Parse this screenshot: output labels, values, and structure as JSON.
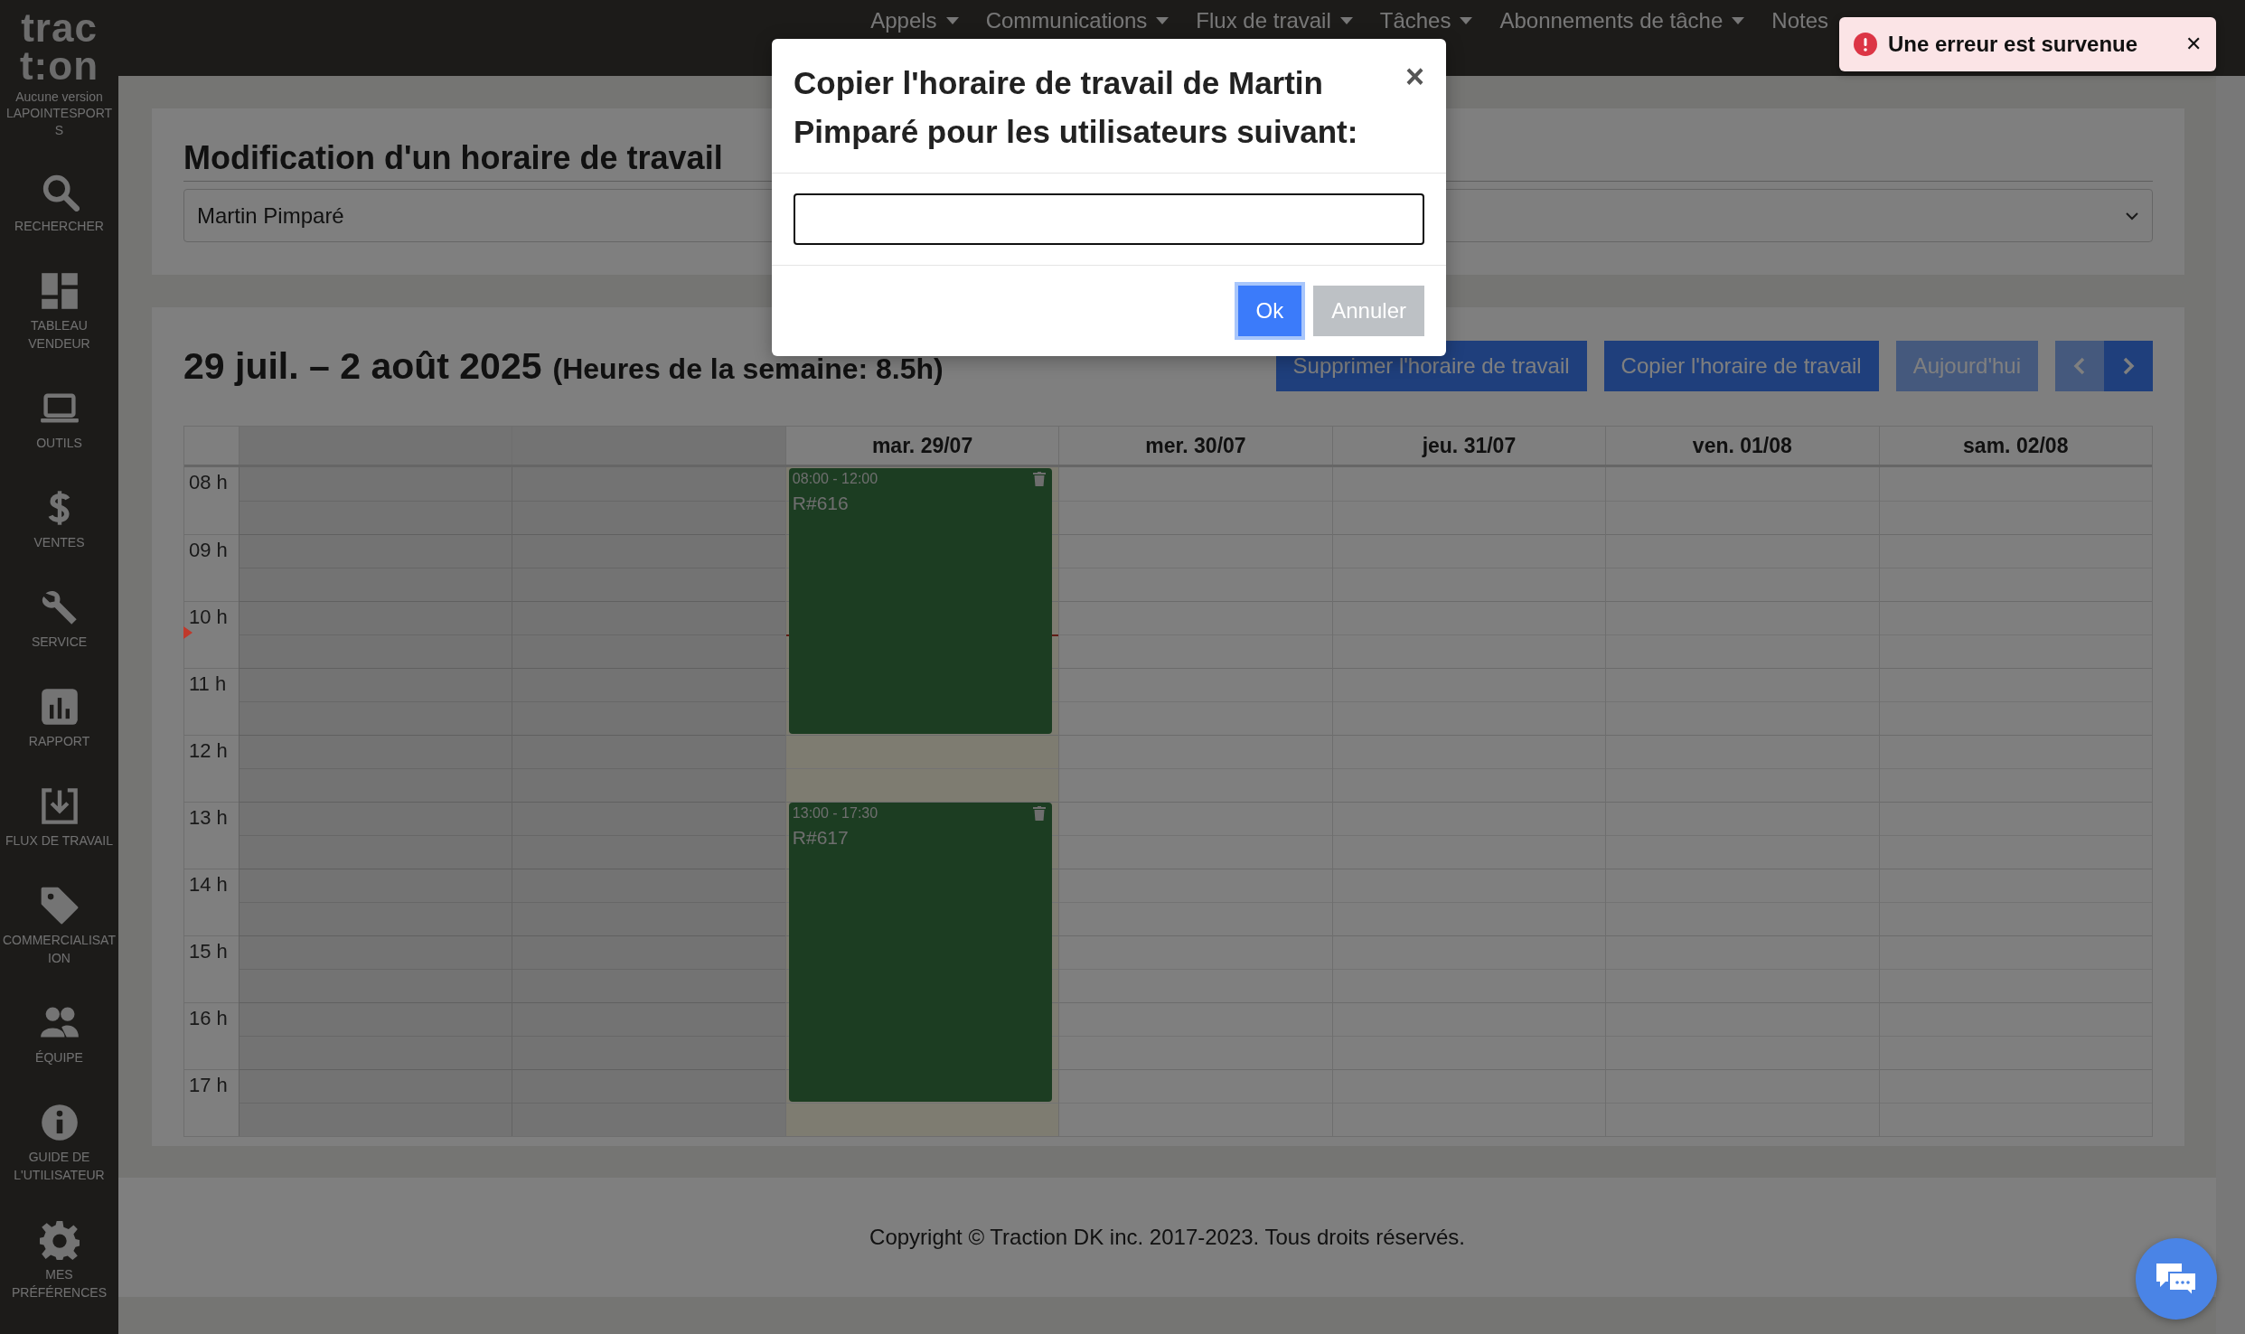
{
  "sidebar": {
    "logo": [
      "trac",
      "t:on"
    ],
    "version_note": "Aucune version LAPOINTESPORTS",
    "items": [
      {
        "label": "RECHERCHER"
      },
      {
        "label": "TABLEAU VENDEUR"
      },
      {
        "label": "OUTILS"
      },
      {
        "label": "VENTES"
      },
      {
        "label": "SERVICE"
      },
      {
        "label": "RAPPORT"
      },
      {
        "label": "FLUX DE TRAVAIL"
      },
      {
        "label": "COMMERCIALISATION"
      },
      {
        "label": "ÉQUIPE"
      },
      {
        "label": "GUIDE DE L'UTILISATEUR"
      },
      {
        "label": "MES PRÉFÉRENCES"
      }
    ]
  },
  "nav": {
    "items": [
      {
        "label": "Appels",
        "dropdown": true
      },
      {
        "label": "Communications",
        "dropdown": true
      },
      {
        "label": "Flux de travail",
        "dropdown": true
      },
      {
        "label": "Tâches",
        "dropdown": true
      },
      {
        "label": "Abonnements de tâche",
        "dropdown": true
      },
      {
        "label": "Notes",
        "dropdown": false
      }
    ]
  },
  "editor": {
    "title": "Modification d'un horaire de travail",
    "user_select": {
      "value": "Martin Pimparé"
    }
  },
  "calendar": {
    "title": "29 juil. – 2 août 2025",
    "subtitle": "(Heures de la semaine: 8.5h)",
    "buttons": [
      {
        "label": "Supprimer l'horaire de travail",
        "disabled": false
      },
      {
        "label": "Copier l'horaire de travail",
        "disabled": false
      },
      {
        "label": "Aujourd'hui",
        "disabled": true
      }
    ],
    "nav_buttons": [
      {
        "kind": "prev",
        "disabled": true
      },
      {
        "kind": "next",
        "disabled": false
      }
    ],
    "columns": [
      {
        "disabled": true,
        "today": false
      },
      {
        "disabled": true,
        "today": false
      },
      {
        "label": "mar. 29/07",
        "disabled": false,
        "today": true,
        "now_marker": true,
        "events": [
          {
            "time": "08:00 - 12:00",
            "title": "R#616"
          },
          {
            "time": "13:00 - 17:30",
            "title": "R#617"
          }
        ]
      },
      {
        "label": "mer. 30/07",
        "disabled": false,
        "today": false
      },
      {
        "label": "jeu. 31/07",
        "disabled": false,
        "today": false
      },
      {
        "label": "ven. 01/08",
        "disabled": false,
        "today": false
      },
      {
        "label": "sam. 02/08",
        "disabled": false,
        "today": false
      }
    ],
    "hours": [
      "08 h",
      "09 h",
      "10 h",
      "11 h",
      "12 h",
      "13 h",
      "14 h",
      "15 h",
      "16 h",
      "17 h"
    ]
  },
  "footer": {
    "text": "Copyright © Traction DK inc. 2017-2023. Tous droits réservés."
  },
  "modal": {
    "title": "Copier l'horaire de travail de Martin Pimparé pour les utilisateurs suivant:",
    "close": "×",
    "input": {
      "focused": true
    },
    "buttons": [
      {
        "label": "Ok",
        "kind": "primary",
        "focused": true
      },
      {
        "label": "Annuler",
        "kind": "secondary",
        "focused": false
      }
    ]
  },
  "toast": {
    "message": "Une erreur est survenue",
    "close": "✕"
  }
}
